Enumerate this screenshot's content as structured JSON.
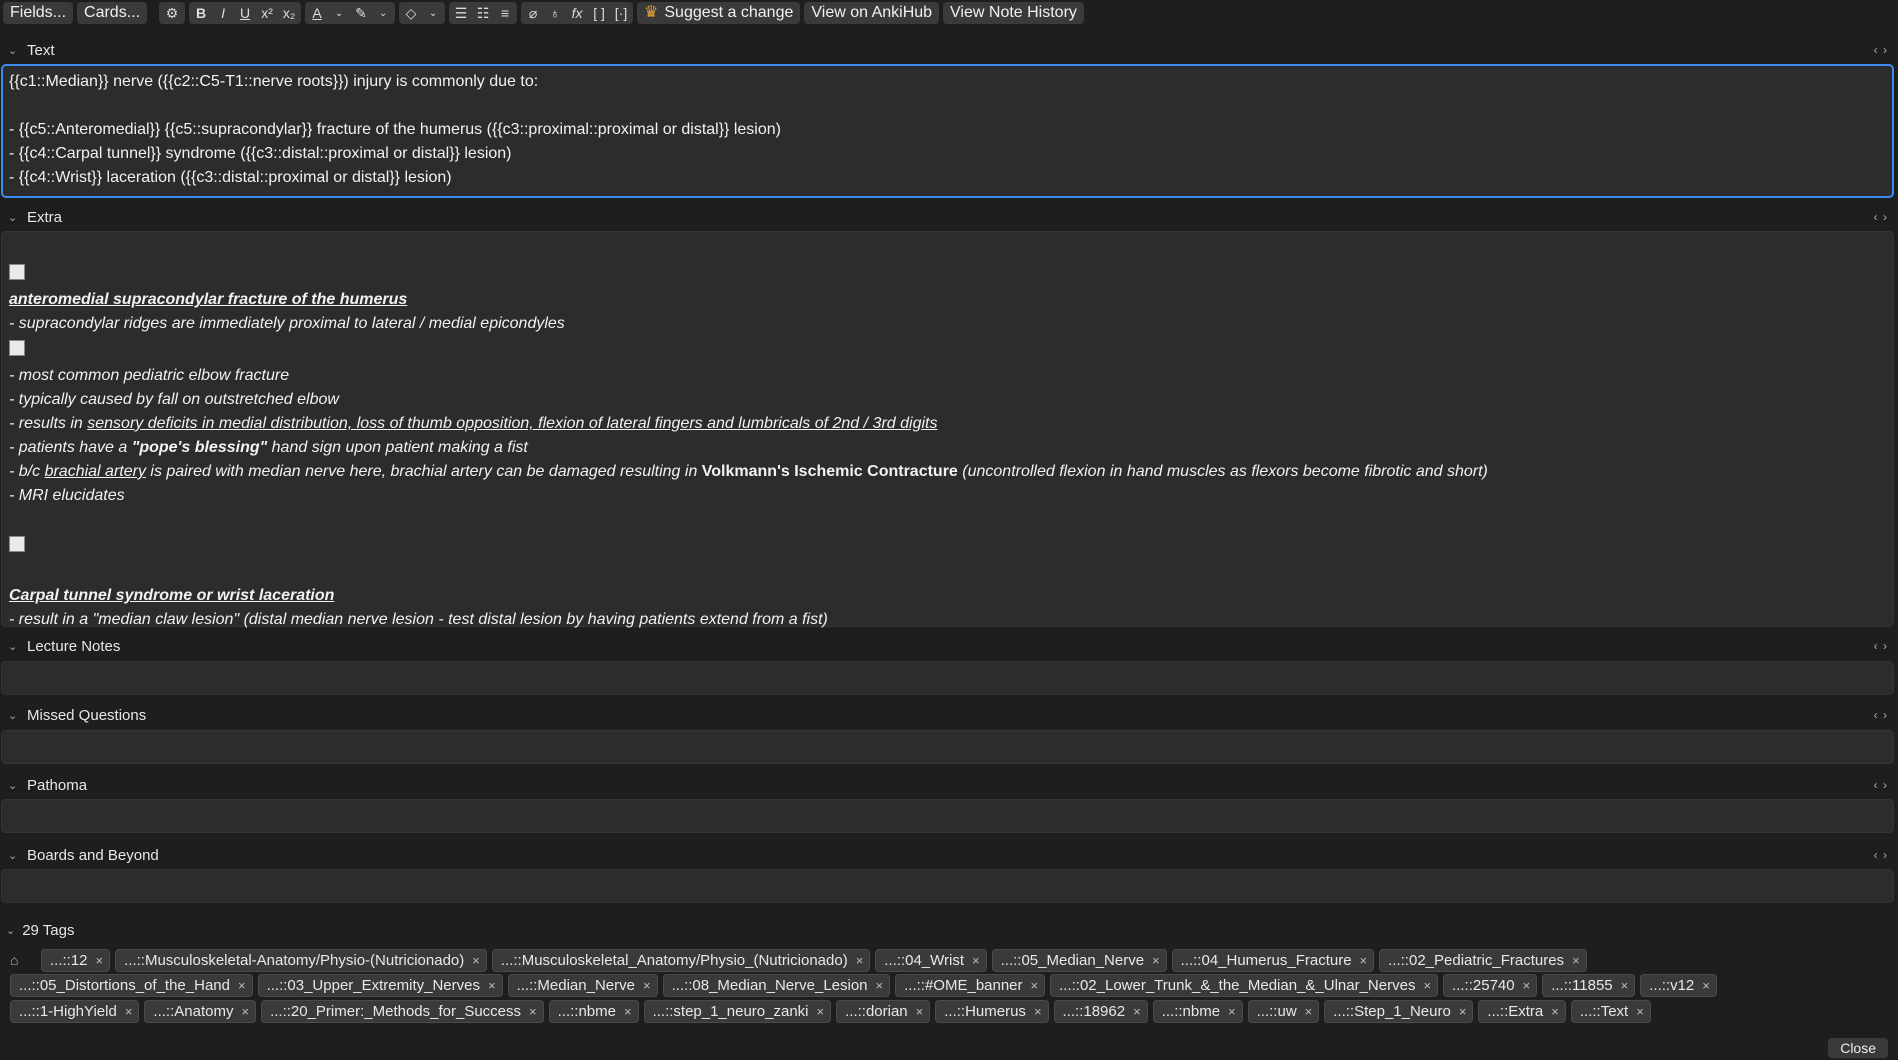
{
  "toolbar": {
    "fields_label": "Fields...",
    "cards_label": "Cards...",
    "suggest_label": "Suggest a change",
    "view_ankihub_label": "View on AnkiHub",
    "view_history_label": "View Note History"
  },
  "fields": {
    "text": {
      "label": "Text",
      "lines": [
        "{{c1::Median}} nerve ({{c2::C5-T1::nerve roots}}) injury is commonly due to:",
        "",
        "- {{c5::Anteromedial}} {{c5::supracondylar}} fracture of the humerus ({{c3::proximal::proximal or distal}} lesion)",
        "- {{c4::Carpal tunnel}} syndrome ({{c3::distal::proximal or distal}} lesion)",
        "- {{c4::Wrist}} laceration ({{c3::distal::proximal or distal}} lesion)"
      ]
    },
    "extra": {
      "label": "Extra",
      "heading1": "anteromedial supracondylar fracture of the humerus",
      "line1": "- supracondylar ridges are immediately proximal to lateral / medial epicondyles",
      "line2": "- most common pediatric elbow fracture",
      "line3": "- typically caused by fall on outstretched elbow",
      "line4_pre": "- results in ",
      "line4_u": "sensory deficits in medial distribution, loss of thumb opposition, flexion of lateral fingers and lumbricals of 2nd / 3rd digits",
      "line5_pre": "- patients have a ",
      "line5_b": "\"pope's blessing\"",
      "line5_post": " hand sign upon patient making a fist",
      "line6_pre": "- b/c ",
      "line6_u": "brachial artery",
      "line6_mid": " is paired with median nerve here, brachial artery can be damaged resulting in ",
      "line6_b": "Volkmann's Ischemic Contracture",
      "line6_post": " (uncontrolled flexion in hand muscles as flexors become fibrotic and short)",
      "line7": "- MRI elucidates",
      "heading2": "Carpal tunnel syndrome or wrist laceration",
      "line8": "- result in a \"median claw lesion\" (distal median nerve lesion - test distal lesion by having patients extend from a fist)"
    },
    "lecture_notes": {
      "label": "Lecture Notes"
    },
    "missed_questions": {
      "label": "Missed Questions"
    },
    "pathoma": {
      "label": "Pathoma"
    },
    "boards_beyond": {
      "label": "Boards and Beyond"
    }
  },
  "tags": {
    "count_label": "29 Tags",
    "row1": [
      "...::12",
      "...::Musculoskeletal-Anatomy/Physio-(Nutricionado)",
      "...::Musculoskeletal_Anatomy/Physio_(Nutricionado)",
      "...::04_Wrist",
      "...::05_Median_Nerve",
      "...::04_Humerus_Fracture",
      "...::02_Pediatric_Fractures"
    ],
    "row2": [
      "...::05_Distortions_of_the_Hand",
      "...::03_Upper_Extremity_Nerves",
      "...::Median_Nerve",
      "...::08_Median_Nerve_Lesion",
      "...::#OME_banner",
      "...::02_Lower_Trunk_&_the_Median_&_Ulnar_Nerves",
      "...::25740",
      "...::11855",
      "...::v12"
    ],
    "row3": [
      "...::1-HighYield",
      "...::Anatomy",
      "...::20_Primer:_Methods_for_Success",
      "...::nbme",
      "...::step_1_neuro_zanki",
      "...::dorian",
      "...::Humerus",
      "...::18962",
      "...::nbme",
      "...::uw",
      "...::Step_1_Neuro",
      "...::Extra",
      "...::Text"
    ]
  },
  "footer": {
    "close_label": "Close"
  }
}
